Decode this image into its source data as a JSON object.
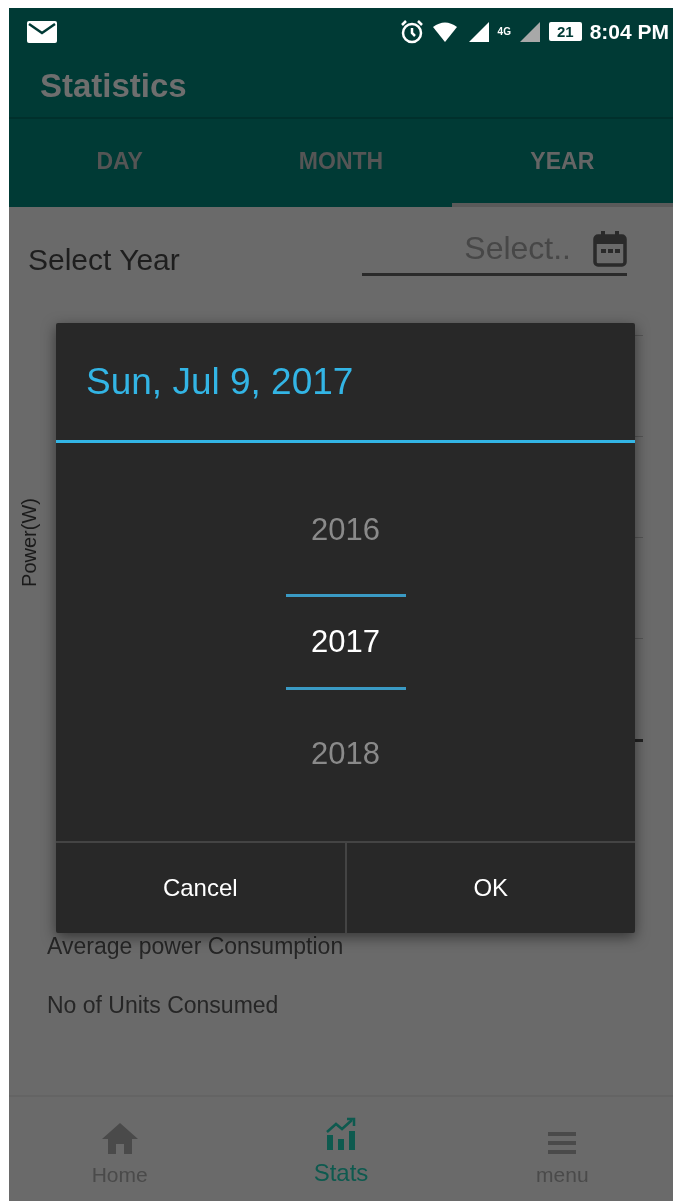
{
  "status_bar": {
    "network": "4G",
    "battery": "21",
    "time": "8:04 PM"
  },
  "app_bar": {
    "title": "Statistics"
  },
  "tabs": [
    {
      "label": "DAY",
      "selected": false
    },
    {
      "label": "MONTH",
      "selected": false
    },
    {
      "label": "YEAR",
      "selected": true
    }
  ],
  "year_select": {
    "label": "Select Year",
    "placeholder": "Select.."
  },
  "chart": {
    "y_axis_label": "Power(W)"
  },
  "summary": [
    "Average power Consumption",
    "No of Units Consumed"
  ],
  "dialog": {
    "header_date": "Sun, Jul 9, 2017",
    "years": [
      {
        "label": "2016",
        "selected": false
      },
      {
        "label": "2017",
        "selected": true
      },
      {
        "label": "2018",
        "selected": false
      }
    ],
    "buttons": [
      "Cancel",
      "OK"
    ]
  },
  "bottom_nav": [
    {
      "label": "Home",
      "selected": false
    },
    {
      "label": "Stats",
      "selected": true
    },
    {
      "label": "menu",
      "selected": false
    }
  ]
}
